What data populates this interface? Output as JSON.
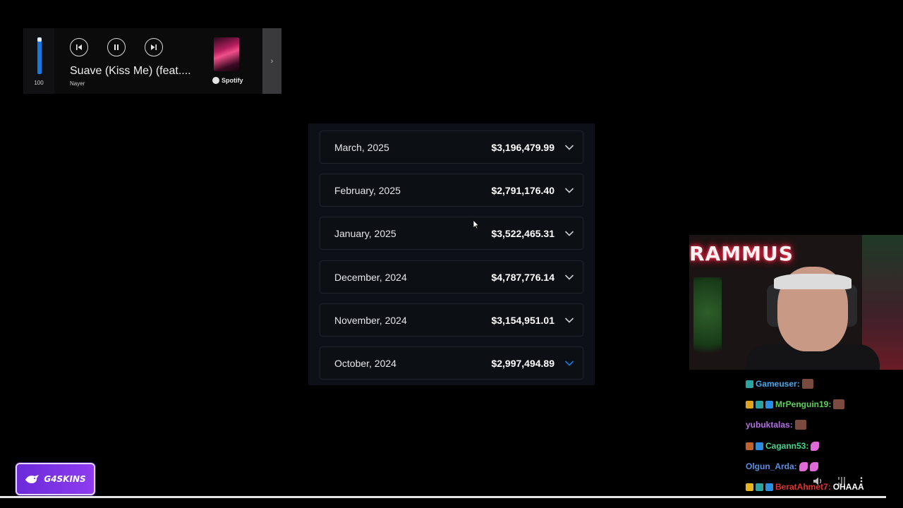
{
  "media_widget": {
    "volume_value": "100",
    "volume_level": 1.0,
    "track_title": "Suave (Kiss Me) (feat....",
    "track_artist": "Nayer",
    "source_label": "Spotify",
    "expand_glyph": "›",
    "controls": [
      {
        "icon": "skip-back-icon"
      },
      {
        "icon": "pause-icon"
      },
      {
        "icon": "skip-forward-icon"
      }
    ]
  },
  "months": [
    {
      "label": "March, 2025",
      "amount": "$3,196,479.99",
      "expanded": false
    },
    {
      "label": "February, 2025",
      "amount": "$2,791,176.40",
      "expanded": false
    },
    {
      "label": "January, 2025",
      "amount": "$3,522,465.31",
      "expanded": false
    },
    {
      "label": "December, 2024",
      "amount": "$4,787,776.14",
      "expanded": false
    },
    {
      "label": "November, 2024",
      "amount": "$3,154,951.01",
      "expanded": false
    },
    {
      "label": "October, 2024",
      "amount": "$2,997,494.89",
      "expanded": true
    }
  ],
  "webcam": {
    "sign_text": "RAMMUS"
  },
  "chat": [
    {
      "user": "Gameuser:",
      "color": "#4aa7e8",
      "badges": [
        "#2aa3a3"
      ],
      "emotes": [
        "emote"
      ]
    },
    {
      "user": "MrPenguin19:",
      "color": "#5fd15a",
      "badges": [
        "#e0a51c",
        "#2aa3a3",
        "#2a8de0"
      ],
      "emotes": [
        "emote"
      ]
    },
    {
      "user": "yubuktalas:",
      "color": "#b46fe6",
      "badges": [],
      "emotes": [
        "emote"
      ]
    },
    {
      "user": "Cagann53:",
      "color": "#48d48a",
      "badges": [
        "#c0622a",
        "#2a8de0"
      ],
      "emotes": [
        "pink"
      ]
    },
    {
      "user": "Olgun_Arda:",
      "color": "#5a8fe0",
      "badges": [],
      "emotes": [
        "pink",
        "pink"
      ]
    },
    {
      "user": "BeratAhmet7:",
      "color": "#e0332e",
      "badges": [
        "#e6b41c",
        "#2aa3a3",
        "#2a8de0"
      ],
      "emotes": [],
      "message": "OHAAA"
    }
  ],
  "accent_color": "#1679e0",
  "sponsor": {
    "label": "G4SKINS"
  }
}
